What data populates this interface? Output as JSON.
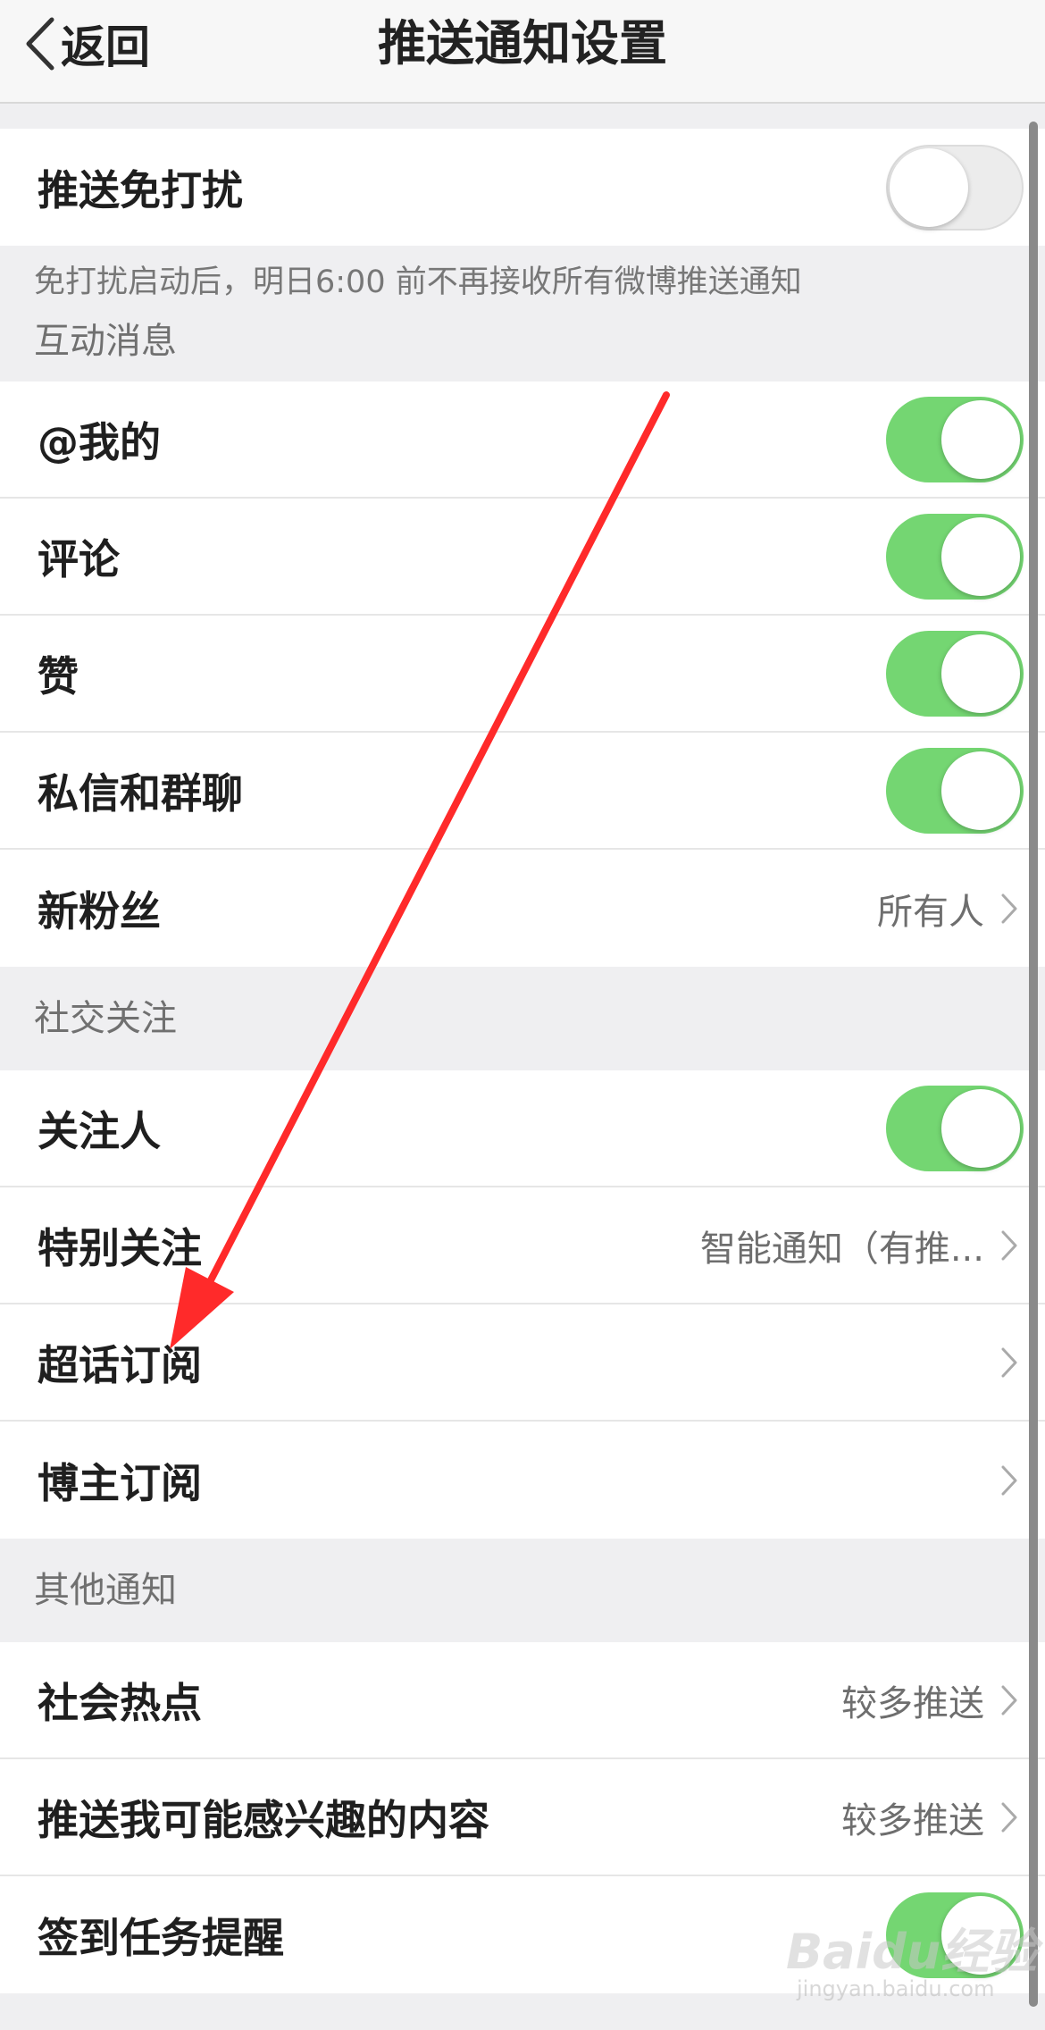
{
  "navbar": {
    "back_label": "返回",
    "title": "推送通知设置"
  },
  "dnd": {
    "label": "推送免打扰",
    "enabled": false,
    "note": "免打扰启动后，明日6:00 前不再接收所有微博推送通知"
  },
  "interaction": {
    "header": "互动消息",
    "items": [
      {
        "label": "@我的",
        "toggle": true
      },
      {
        "label": "评论",
        "toggle": true
      },
      {
        "label": "赞",
        "toggle": true
      },
      {
        "label": "私信和群聊",
        "toggle": true
      },
      {
        "label": "新粉丝",
        "value": "所有人"
      }
    ]
  },
  "social": {
    "header": "社交关注",
    "items": [
      {
        "label": "关注人",
        "toggle": true
      },
      {
        "label": "特别关注",
        "value": "智能通知（有推..."
      },
      {
        "label": "超话订阅",
        "value": ""
      },
      {
        "label": "博主订阅",
        "value": ""
      }
    ]
  },
  "other": {
    "header": "其他通知",
    "items": [
      {
        "label": "社会热点",
        "value": "较多推送"
      },
      {
        "label": "推送我可能感兴趣的内容",
        "value": "较多推送"
      },
      {
        "label": "签到任务提醒",
        "toggle": true
      }
    ]
  },
  "watermark": {
    "brand": "Baidu经验",
    "url": "jingyan.baidu.com"
  },
  "colors": {
    "toggle_on": "#74d672",
    "annotation_arrow": "#ff2a2a",
    "background": "#efeff1"
  }
}
